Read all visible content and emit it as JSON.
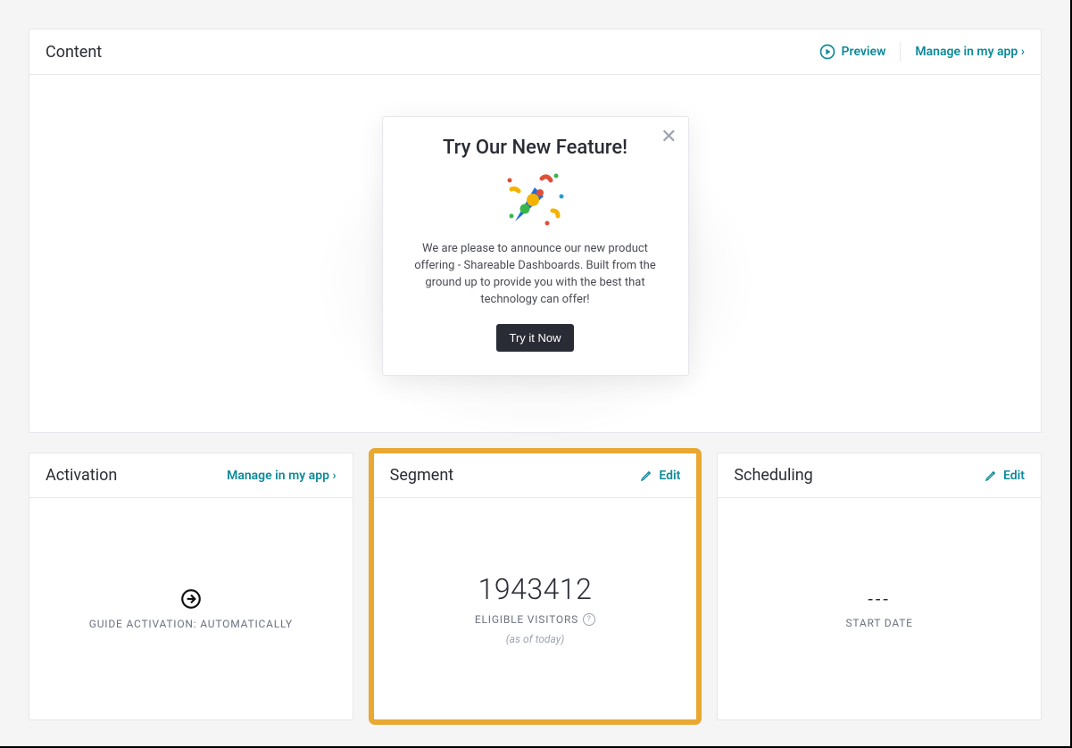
{
  "content": {
    "title": "Content",
    "preview_label": "Preview",
    "manage_label": "Manage in my app ›"
  },
  "modal": {
    "title": "Try Our New Feature!",
    "text": "We are please to announce our new product offering - Shareable Dashboards. Built from the ground up to provide you with the best that technology can offer!",
    "button_label": "Try it Now"
  },
  "activation": {
    "title": "Activation",
    "manage_label": "Manage in my app ›",
    "line": "GUIDE ACTIVATION: AUTOMATICALLY"
  },
  "segment": {
    "title": "Segment",
    "edit_label": "Edit",
    "count": "1943412",
    "visitors_label": "ELIGIBLE VISITORS",
    "asof": "(as of today)"
  },
  "scheduling": {
    "title": "Scheduling",
    "edit_label": "Edit",
    "dashes": "---",
    "start_label": "START DATE"
  }
}
